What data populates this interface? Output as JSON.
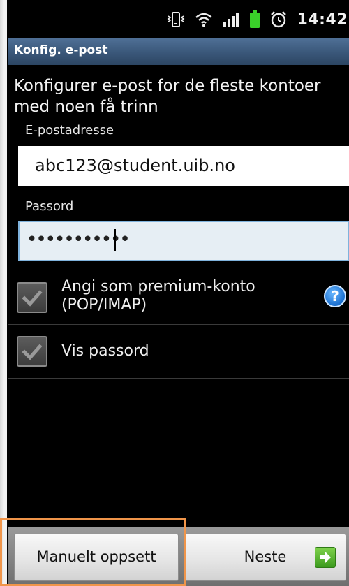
{
  "status_bar": {
    "time": "14:42",
    "icons": [
      "vibrate-icon",
      "wifi-icon",
      "signal-icon",
      "battery-icon",
      "alarm-icon"
    ],
    "battery_color": "#3ad02a"
  },
  "title_bar": {
    "title": "Konfig. e-post",
    "color": "#3a5779"
  },
  "intro": {
    "text": "Konfigurer e-post for de fleste kontoer med noen få trinn"
  },
  "email": {
    "label": "E-postadresse",
    "value": "abc123@student.uib.no"
  },
  "password": {
    "label": "Passord",
    "value": "•••••••••••",
    "focused": true,
    "focus_color": "#7fb2dc"
  },
  "options": [
    {
      "label_line1": "Angi som premium-konto",
      "label_line2": "(POP/IMAP)",
      "checked": true,
      "has_help": true
    },
    {
      "label": "Vis passord",
      "checked": true
    }
  ],
  "help": {
    "glyph": "?"
  },
  "buttons": {
    "manual": "Manuelt oppsett",
    "next": "Neste"
  },
  "highlight_color": "#f0954a"
}
